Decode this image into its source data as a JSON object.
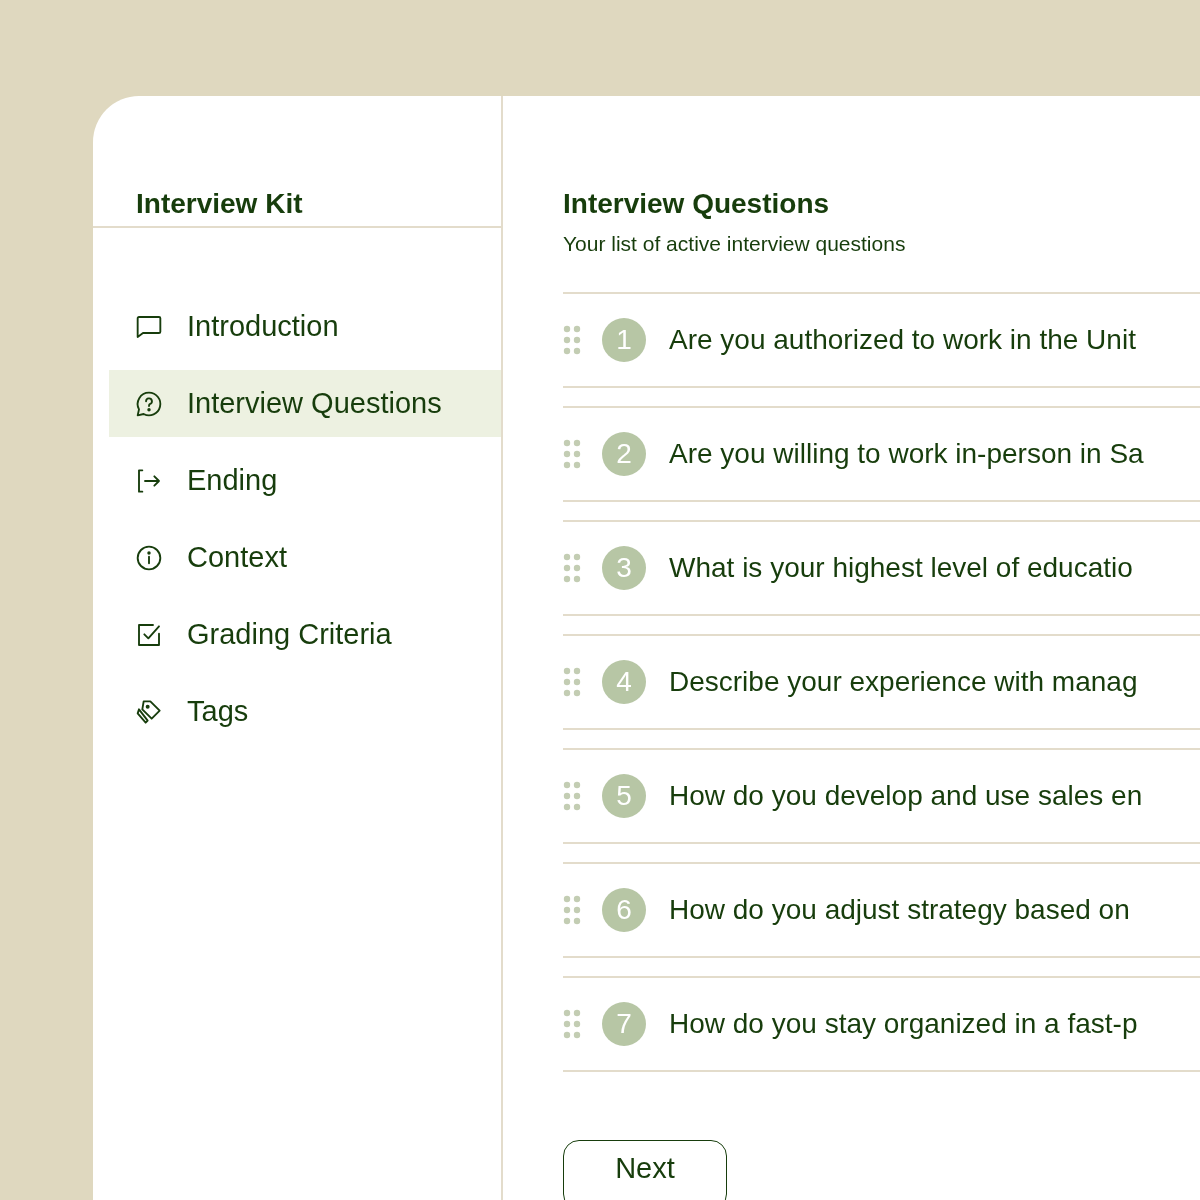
{
  "sidebar": {
    "title": "Interview Kit",
    "items": [
      {
        "label": "Introduction",
        "selected": false
      },
      {
        "label": "Interview Questions",
        "selected": true
      },
      {
        "label": "Ending",
        "selected": false
      },
      {
        "label": "Context",
        "selected": false
      },
      {
        "label": "Grading Criteria",
        "selected": false
      },
      {
        "label": "Tags",
        "selected": false
      }
    ]
  },
  "main": {
    "title": "Interview Questions",
    "subtitle": "Your list of active interview questions",
    "questions": [
      {
        "number": "1",
        "text": "Are you authorized to work in the Unit"
      },
      {
        "number": "2",
        "text": "Are you willing to work in-person in Sa"
      },
      {
        "number": "3",
        "text": "What is your highest level of educatio"
      },
      {
        "number": "4",
        "text": "Describe your experience with manag"
      },
      {
        "number": "5",
        "text": "How do you develop and use sales en"
      },
      {
        "number": "6",
        "text": "How do you adjust strategy based on"
      },
      {
        "number": "7",
        "text": "How do you stay organized in a fast-p"
      }
    ],
    "next_button": "Next"
  }
}
